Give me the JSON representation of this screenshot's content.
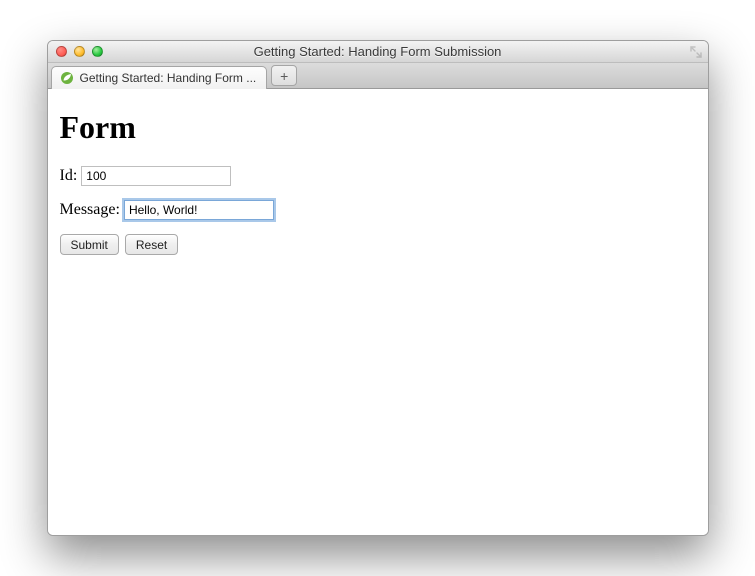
{
  "window": {
    "title": "Getting Started: Handing Form Submission"
  },
  "tabs": {
    "active": {
      "label": "Getting Started: Handing Form ..."
    }
  },
  "page": {
    "heading": "Form",
    "form": {
      "id_label": "Id:",
      "id_value": "100",
      "message_label": "Message:",
      "message_value": "Hello, World!",
      "submit_label": "Submit",
      "reset_label": "Reset"
    }
  }
}
